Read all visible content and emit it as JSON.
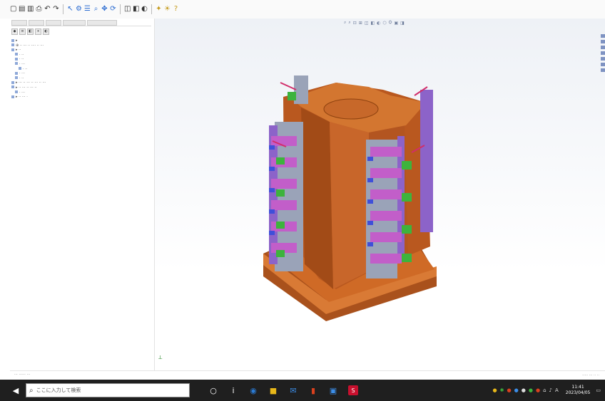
{
  "toolbar": {
    "groups": [
      [
        "new-icon",
        "open-icon",
        "save-icon",
        "print-icon",
        "undo-icon",
        "redo-icon"
      ],
      [
        "select-icon",
        "rebuild-icon",
        "options-icon",
        "zoom-icon",
        "pan-icon",
        "rotate-icon"
      ],
      [
        "view-icon",
        "section-icon",
        "display-icon"
      ],
      [
        "render-icon",
        "scene-icon",
        "help-icon"
      ]
    ]
  },
  "panel": {
    "tree_items": [
      {
        "depth": 0,
        "text": "▸"
      },
      {
        "depth": 0,
        "text": "⊕ ·· ··· ·· ···· ·· ···"
      },
      {
        "depth": 0,
        "text": "▸ ··"
      },
      {
        "depth": 1,
        "text": "· ··"
      },
      {
        "depth": 1,
        "text": "· ··"
      },
      {
        "depth": 1,
        "text": "· ···"
      },
      {
        "depth": 2,
        "text": "· ··"
      },
      {
        "depth": 1,
        "text": "· ···"
      },
      {
        "depth": 1,
        "text": "· ··"
      },
      {
        "depth": 0,
        "text": "▸ ··· ·· ··· ·· ··· ·· ···"
      },
      {
        "depth": 0,
        "text": "▸ ·· ··· ·· ··· ··"
      },
      {
        "depth": 1,
        "text": "· ···"
      },
      {
        "depth": 0,
        "text": "▸ ·· ··· ·"
      }
    ]
  },
  "viewport": {
    "hud_glyphs": [
      "⌕",
      "⌕",
      "⊡",
      "⊞",
      "◫",
      "◧",
      "◐",
      "⬡",
      "⛭",
      "▣",
      "◨"
    ],
    "triad": "⟂"
  },
  "statusbar": {
    "left": "··· ······ ···",
    "right": "····· ··· ·· ··"
  },
  "taskbar": {
    "search_text": "ここに入力して検索",
    "clock_time": "11:41",
    "clock_date": "2023/04/05",
    "colors": {
      "edge": "#2b7bd4",
      "explorer": "#e8b81a",
      "office": "#d9411e",
      "solidworks": "#c8102e"
    }
  }
}
